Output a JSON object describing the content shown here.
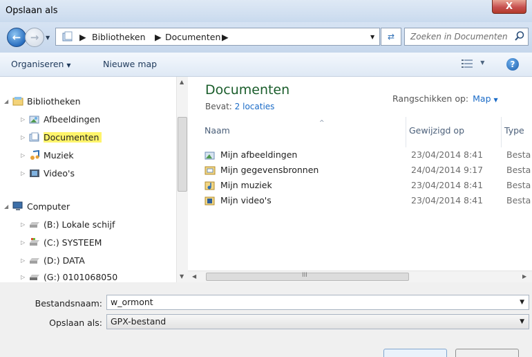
{
  "window": {
    "title": "Opslaan als",
    "close_label": "X"
  },
  "address": {
    "crumbs": [
      "Bibliotheken",
      "Documenten"
    ],
    "separator": "▶"
  },
  "search": {
    "placeholder": "Zoeken in Documenten"
  },
  "toolbar": {
    "organize_label": "Organiseren",
    "new_folder_label": "Nieuwe map"
  },
  "nav_tree": {
    "libraries_label": "Bibliotheken",
    "libraries": [
      "Afbeeldingen",
      "Documenten",
      "Muziek",
      "Video's"
    ],
    "computer_label": "Computer",
    "drives": [
      "(B:) Lokale schijf",
      "(C:) SYSTEEM",
      "(D:) DATA",
      "(G:) 0101068050"
    ]
  },
  "library": {
    "title": "Documenten",
    "includes_label": "Bevat:",
    "includes_value": "2 locaties",
    "arrange_label": "Rangschikken op:",
    "arrange_value": "Map"
  },
  "columns": {
    "name": "Naam",
    "modified": "Gewijzigd op",
    "type": "Type"
  },
  "files": [
    {
      "name": "Mijn afbeeldingen",
      "date": "23/04/2014 8:41",
      "type": "Besta"
    },
    {
      "name": "Mijn gegevensbronnen",
      "date": "24/04/2014 9:17",
      "type": "Besta"
    },
    {
      "name": "Mijn muziek",
      "date": "23/04/2014 8:41",
      "type": "Besta"
    },
    {
      "name": "Mijn video's",
      "date": "23/04/2014 8:41",
      "type": "Besta"
    }
  ],
  "form": {
    "filename_label": "Bestandsnaam:",
    "filename_value": "w_ormont",
    "save_as_label": "Opslaan als:",
    "save_as_value": "GPX-bestand"
  },
  "colors": {
    "selection_highlight": "#fff46b",
    "library_title": "#1a5d2b",
    "link": "#1a6bc7"
  },
  "scrollbar": {
    "h_glyph": "III"
  }
}
